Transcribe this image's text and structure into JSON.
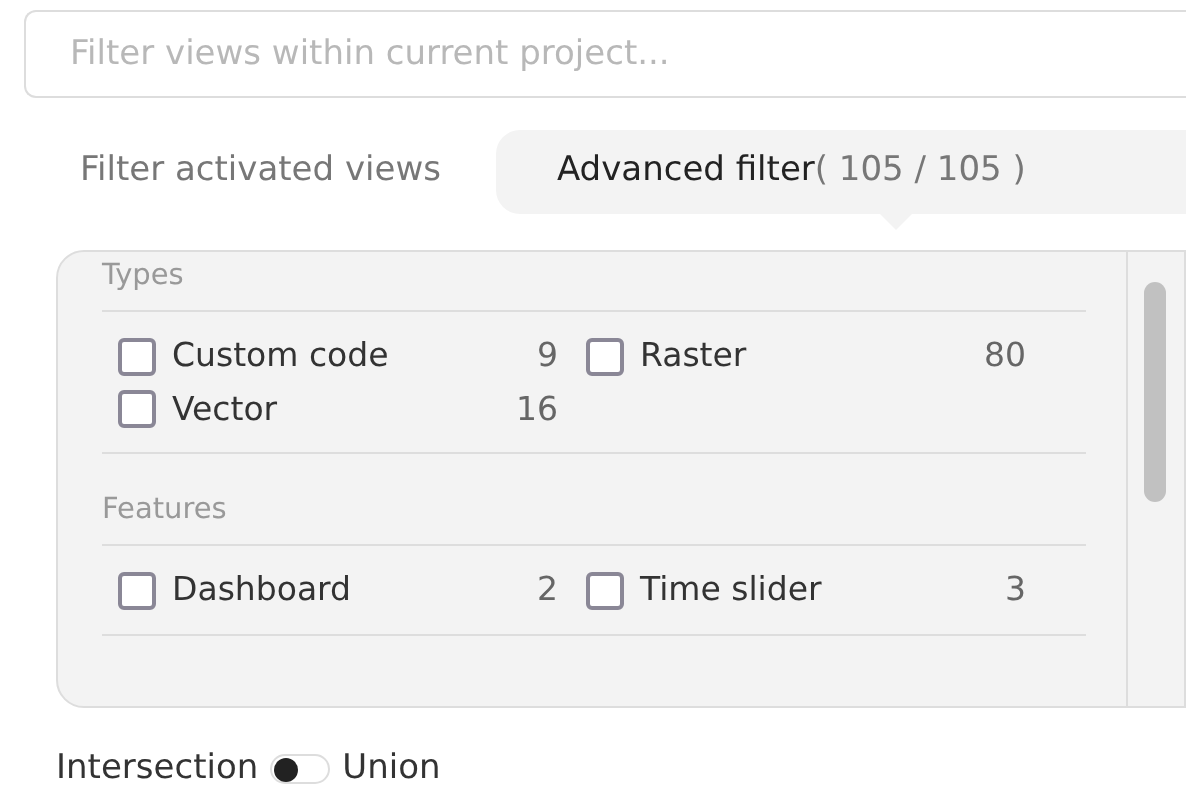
{
  "search": {
    "placeholder": "Filter views within current project..."
  },
  "tabs": [
    {
      "label": "Filter activated views",
      "selected": false
    },
    {
      "label": "Advanced filter",
      "count": "( 105 / 105 )",
      "selected": true
    }
  ],
  "sections": [
    {
      "title": "Types",
      "items": [
        {
          "label": "Custom code",
          "count": "9",
          "checked": false
        },
        {
          "label": "Raster",
          "count": "80",
          "checked": false
        },
        {
          "label": "Vector",
          "count": "16",
          "checked": false
        }
      ]
    },
    {
      "title": "Features",
      "items": [
        {
          "label": "Dashboard",
          "count": "2",
          "checked": false
        },
        {
          "label": "Time slider",
          "count": "3",
          "checked": false
        }
      ]
    }
  ],
  "mode": {
    "left_label": "Intersection",
    "right_label": "Union",
    "on": false
  }
}
